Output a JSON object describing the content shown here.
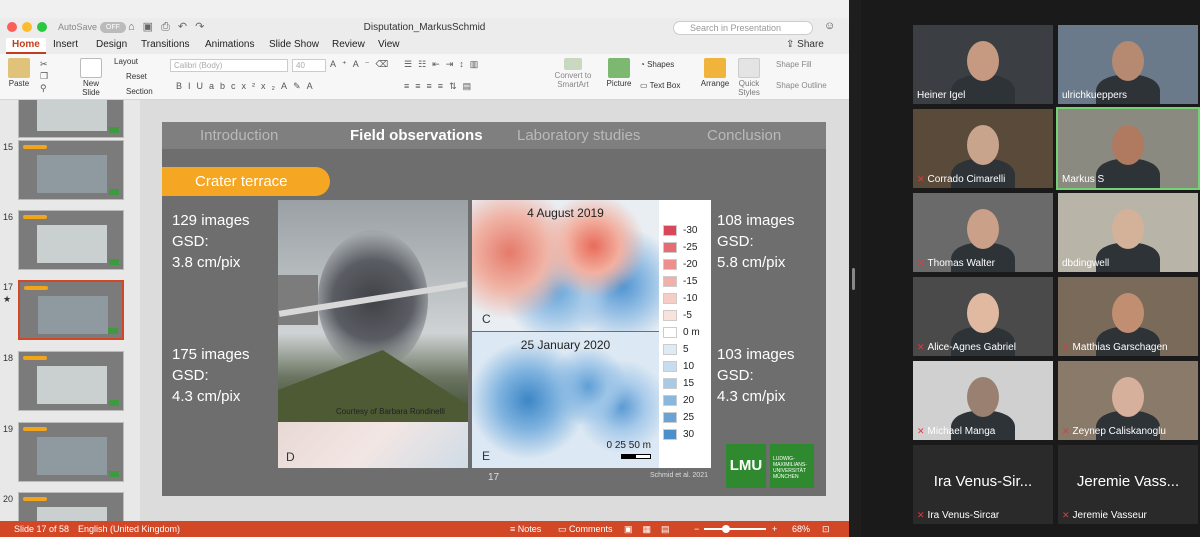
{
  "ppt": {
    "autosave_label": "AutoSave",
    "autosave_state": "OFF",
    "doc_title": "Disputation_MarkusSchmid",
    "search_placeholder": "Search in Presentation",
    "share_label": "Share",
    "tabs": [
      "Home",
      "Insert",
      "Design",
      "Transitions",
      "Animations",
      "Slide Show",
      "Review",
      "View"
    ],
    "ribbon": {
      "paste": "Paste",
      "new_slide": "New Slide",
      "layout": "Layout",
      "reset": "Reset",
      "section": "Section",
      "font_name": "Calibri (Body)",
      "font_size": "40",
      "convert_smartart": "Convert to SmartArt",
      "picture": "Picture",
      "shapes": "Shapes",
      "text_box": "Text Box",
      "arrange": "Arrange",
      "quick_styles": "Quick Styles",
      "shape_fill": "Shape Fill",
      "shape_outline": "Shape Outline"
    },
    "thumbnails": [
      {
        "num": "",
        "selected": false
      },
      {
        "num": "15",
        "selected": false
      },
      {
        "num": "16",
        "selected": false
      },
      {
        "num": "17",
        "selected": true
      },
      {
        "num": "18",
        "selected": false
      },
      {
        "num": "19",
        "selected": false
      },
      {
        "num": "20",
        "selected": false
      }
    ],
    "slide": {
      "nav": [
        "Introduction",
        "Field observations",
        "Laboratory studies",
        "Conclusion"
      ],
      "section_tag": "Crater terrace",
      "stats": [
        {
          "images": "129 images",
          "gsd": "GSD:",
          "value": "3.8 cm/pix"
        },
        {
          "images": "108 images",
          "gsd": "GSD:",
          "value": "5.8 cm/pix"
        },
        {
          "images": "175 images",
          "gsd": "GSD:",
          "value": "4.3 cm/pix"
        },
        {
          "images": "103 images",
          "gsd": "GSD:",
          "value": "4.3 cm/pix"
        }
      ],
      "photo_credit": "Courtesy of Barbara Rondinelli",
      "panel_d": "D",
      "map_c_title": "4 August 2019",
      "map_c_label": "C",
      "map_e_title": "25 January 2020",
      "map_e_label": "E",
      "scale_text": "0  25 50 m",
      "legend": [
        {
          "label": "-30",
          "color": "#d9475a"
        },
        {
          "label": "-25",
          "color": "#e56c72"
        },
        {
          "label": "-20",
          "color": "#ec8f8d"
        },
        {
          "label": "-15",
          "color": "#f2b1a8"
        },
        {
          "label": "-10",
          "color": "#f6cdc4"
        },
        {
          "label": "-5",
          "color": "#f9e2dc"
        },
        {
          "label": "0 m",
          "color": "#ffffff"
        },
        {
          "label": "5",
          "color": "#deebf5"
        },
        {
          "label": "10",
          "color": "#c7dcee"
        },
        {
          "label": "15",
          "color": "#a9cae6"
        },
        {
          "label": "20",
          "color": "#8ab7de"
        },
        {
          "label": "25",
          "color": "#6aa3d5"
        },
        {
          "label": "30",
          "color": "#4b8fcb"
        }
      ],
      "page_number": "17",
      "citation": "Schmid et al. 2021",
      "lmu_logo": "LMU",
      "lmu_text": "LUDWIG- MAXIMILIANS- UNIVERSITÄT MÜNCHEN"
    },
    "status": {
      "slide_pos": "Slide 17 of 58",
      "language": "English (United Kingdom)",
      "notes": "Notes",
      "comments": "Comments",
      "zoom": "68%"
    }
  },
  "zoom": {
    "participants": [
      {
        "name": "Heiner Igel",
        "muted": false,
        "active": false
      },
      {
        "name": "ulrichkueppers",
        "muted": false,
        "active": false
      },
      {
        "name": "Corrado Cimarelli",
        "muted": true,
        "active": false
      },
      {
        "name": "Markus S",
        "muted": false,
        "active": true
      },
      {
        "name": "Thomas Walter",
        "muted": true,
        "active": false
      },
      {
        "name": "dbdingwell",
        "muted": false,
        "active": false
      },
      {
        "name": "Alice-Agnes Gabriel",
        "muted": true,
        "active": false
      },
      {
        "name": "Matthias Garschagen",
        "muted": true,
        "active": false
      },
      {
        "name": "Michael Manga",
        "muted": true,
        "active": false
      },
      {
        "name": "Zeynep Caliskanoglu",
        "muted": true,
        "active": false
      },
      {
        "name": "Ira Venus-Sircar",
        "muted": true,
        "active": false,
        "big": "Ira Venus-Sir..."
      },
      {
        "name": "Jeremie Vasseur",
        "muted": true,
        "active": false,
        "big": "Jeremie Vass..."
      }
    ]
  }
}
